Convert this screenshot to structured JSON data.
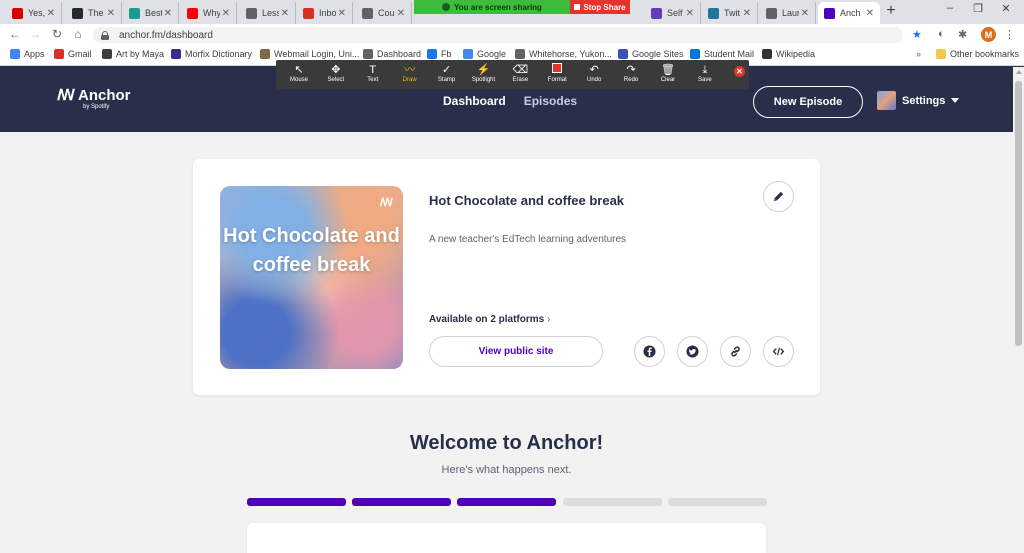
{
  "browser": {
    "tabs": [
      {
        "title": "Yes,",
        "icon": "cbc-icon",
        "color": "#d80000"
      },
      {
        "title": "The",
        "icon": "github-icon",
        "color": "#24292e"
      },
      {
        "title": "Best",
        "icon": "t-icon",
        "color": "#1a9c8c"
      },
      {
        "title": "Why",
        "icon": "youtube-icon",
        "color": "#ff0000"
      },
      {
        "title": "Less",
        "icon": "globe-icon",
        "color": "#5f6368"
      },
      {
        "title": "Inbo",
        "icon": "gmail-icon",
        "color": "#d93025"
      },
      {
        "title": "Cou",
        "icon": "globe-icon",
        "color": "#5f6368"
      },
      {
        "title": "Self",
        "icon": "forms-icon",
        "color": "#673ab7"
      },
      {
        "title": "Twit",
        "icon": "wordpress-icon",
        "color": "#21759b"
      },
      {
        "title": "Laur",
        "icon": "globe-icon",
        "color": "#5f6368"
      },
      {
        "title": "Anch",
        "icon": "anchor-icon",
        "color": "#5000b9"
      }
    ],
    "url": "anchor.fm/dashboard",
    "profile_initial": "M",
    "bookmarks": [
      {
        "label": "Apps",
        "icon": "apps-icon",
        "color": "#4285f4"
      },
      {
        "label": "Gmail",
        "icon": "gmail-icon",
        "color": "#d93025"
      },
      {
        "label": "Art by Maya",
        "icon": "cube-icon",
        "color": "#3c4043"
      },
      {
        "label": "Morfix Dictionary",
        "icon": "morfix-icon",
        "color": "#3d2a8c"
      },
      {
        "label": "Webmail Login, Uni...",
        "icon": "webmail-icon",
        "color": "#7a6a45"
      },
      {
        "label": "Dashboard",
        "icon": "globe-icon",
        "color": "#5f6368"
      },
      {
        "label": "Fb",
        "icon": "facebook-icon",
        "color": "#1877f2"
      },
      {
        "label": "Google",
        "icon": "google-icon",
        "color": "#4285f4"
      },
      {
        "label": "Whitehorse, Yukon...",
        "icon": "globe-icon",
        "color": "#5f6368"
      },
      {
        "label": "Google Sites",
        "icon": "sites-icon",
        "color": "#3f51b5"
      },
      {
        "label": "Student Mail",
        "icon": "outlook-icon",
        "color": "#0078d4"
      },
      {
        "label": "Wikipedia",
        "icon": "wikipedia-icon",
        "color": "#333333"
      }
    ],
    "other_bookmarks": "Other bookmarks"
  },
  "screen_share": {
    "status": "You are screen sharing",
    "stop_label": "Stop Share"
  },
  "annotation_toolbar": {
    "tools": [
      {
        "label": "Mouse",
        "icon": "cursor-icon",
        "glyph": "↖"
      },
      {
        "label": "Select",
        "icon": "move-icon",
        "glyph": "✥"
      },
      {
        "label": "Text",
        "icon": "text-icon",
        "glyph": "T"
      },
      {
        "label": "Draw",
        "icon": "draw-icon",
        "glyph": "〰"
      },
      {
        "label": "Stamp",
        "icon": "check-icon",
        "glyph": "✓"
      },
      {
        "label": "Spotlight",
        "icon": "wand-icon",
        "glyph": "⚡"
      },
      {
        "label": "Erase",
        "icon": "eraser-icon",
        "glyph": "⌫"
      },
      {
        "label": "Format",
        "icon": "color-swatch-icon",
        "glyph": ""
      },
      {
        "label": "Undo",
        "icon": "undo-icon",
        "glyph": "↶"
      },
      {
        "label": "Redo",
        "icon": "redo-icon",
        "glyph": "↷"
      },
      {
        "label": "Clear",
        "icon": "trash-icon",
        "glyph": "🗑"
      },
      {
        "label": "Save",
        "icon": "save-icon",
        "glyph": "⤓"
      }
    ],
    "selected_tool": "Draw"
  },
  "header": {
    "logo_name": "Anchor",
    "logo_sub": "by Spotify",
    "nav": [
      {
        "label": "Dashboard",
        "active": true
      },
      {
        "label": "Episodes",
        "active": false
      }
    ],
    "new_episode": "New Episode",
    "settings": "Settings"
  },
  "podcast": {
    "cover_title": "Hot Chocolate and coffee break",
    "title": "Hot Chocolate and coffee break",
    "description": "A new teacher's EdTech learning adventures",
    "platforms": "Available on 2 platforms",
    "view_site": "View public site"
  },
  "welcome": {
    "title": "Welcome to Anchor!",
    "subtitle": "Here's what happens next.",
    "steps_completed": 3,
    "steps_total": 5,
    "colors": {
      "done": "#5000b9",
      "todo": "#dcdcdc"
    }
  }
}
